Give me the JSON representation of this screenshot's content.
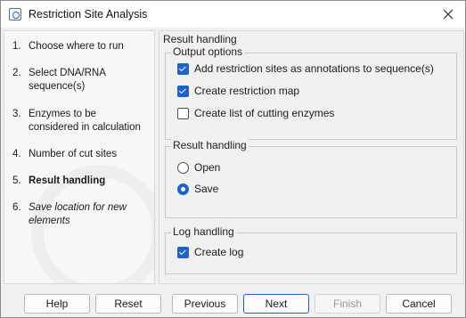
{
  "window": {
    "title": "Restriction Site Analysis"
  },
  "steps": [
    {
      "num": "1.",
      "label": "Choose where to run",
      "state": "done"
    },
    {
      "num": "2.",
      "label": "Select DNA/RNA sequence(s)",
      "state": "done"
    },
    {
      "num": "3.",
      "label": "Enzymes to be considered in calculation",
      "state": "done"
    },
    {
      "num": "4.",
      "label": "Number of cut sites",
      "state": "done"
    },
    {
      "num": "5.",
      "label": "Result handling",
      "state": "active"
    },
    {
      "num": "6.",
      "label": "Save location for new elements",
      "state": "future"
    }
  ],
  "content": {
    "title": "Result handling",
    "output_options": {
      "legend": "Output options",
      "items": [
        {
          "label": "Add restriction sites as annotations to sequence(s)",
          "checked": true
        },
        {
          "label": "Create restriction map",
          "checked": true
        },
        {
          "label": "Create list of cutting enzymes",
          "checked": false
        }
      ]
    },
    "result_handling": {
      "legend": "Result handling",
      "options": [
        {
          "label": "Open",
          "selected": false
        },
        {
          "label": "Save",
          "selected": true
        }
      ]
    },
    "log_handling": {
      "legend": "Log handling",
      "items": [
        {
          "label": "Create log",
          "checked": true
        }
      ]
    }
  },
  "buttons": {
    "help": "Help",
    "reset": "Reset",
    "previous": "Previous",
    "next": "Next",
    "finish": "Finish",
    "cancel": "Cancel"
  },
  "colors": {
    "accent": "#1d62c9"
  }
}
